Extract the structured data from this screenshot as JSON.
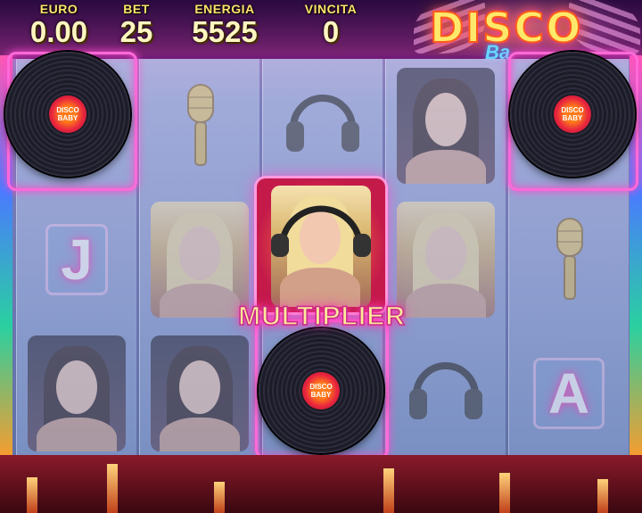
{
  "hud": {
    "euro": {
      "label": "EURO",
      "value": "0.00"
    },
    "bet": {
      "label": "BET",
      "value": "25"
    },
    "energia": {
      "label": "ENERGIA",
      "value": "5525"
    },
    "vincita": {
      "label": "VINCITA",
      "value": "0"
    }
  },
  "logo": {
    "main": "DISCO",
    "sub": "Ba"
  },
  "reels": [
    [
      "vinyl-record",
      "letter-j",
      "brunette-woman"
    ],
    [
      "microphone",
      "blonde-woman",
      "brunette-woman"
    ],
    [
      "headphones",
      "blonde-woman-multiplier",
      "vinyl-record"
    ],
    [
      "brunette-woman",
      "blonde-woman",
      "headphones"
    ],
    [
      "vinyl-record",
      "microphone",
      "letter-a"
    ]
  ],
  "symbols": {
    "letter_j": "J",
    "letter_a": "A",
    "record_label": "DISCO BABY"
  },
  "feature": {
    "label": "MULTIPLIER"
  },
  "colors": {
    "accent": "#ff4ad0",
    "hud_text": "#ffe36a"
  }
}
